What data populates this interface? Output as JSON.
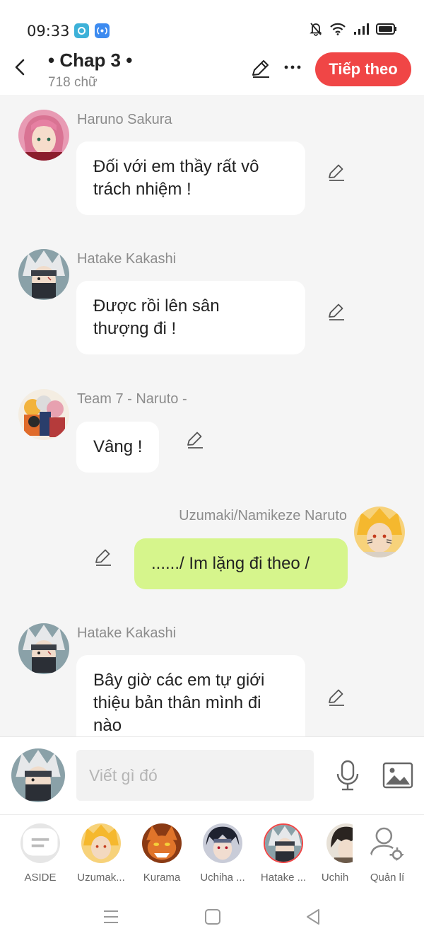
{
  "status_bar": {
    "time": "09:33"
  },
  "header": {
    "chapter_title": "• Chap 3 •",
    "word_count": "718 chữ",
    "next_button": "Tiếp theo"
  },
  "messages": [
    {
      "name": "Haruno Sakura",
      "text_lines": [
        "Đối với em thầy rất vô",
        "trách nhiệm !"
      ]
    },
    {
      "name": "Hatake Kakashi",
      "text_lines": [
        "Được rồi lên sân",
        "thượng đi !"
      ]
    },
    {
      "name": "Team 7 - Naruto -",
      "text_lines": [
        "Vâng !"
      ]
    },
    {
      "name": "Uzumaki/Namikeze Naruto",
      "text_lines": [
        "....../ Im lặng đi theo /"
      ]
    },
    {
      "name": "Hatake Kakashi",
      "text_lines": [
        "Bây giờ các em tự giới",
        "thiệu bản thân mình đi",
        "nào"
      ]
    }
  ],
  "input": {
    "placeholder": "Viết gì đó"
  },
  "characters": [
    {
      "label": "ASIDE"
    },
    {
      "label": "Uzumak..."
    },
    {
      "label": "Kurama"
    },
    {
      "label": "Uchiha ..."
    },
    {
      "label": "Hatake ..."
    },
    {
      "label": "Uchih"
    },
    {
      "label": "Quản lí"
    }
  ],
  "colors": {
    "accent": "#f04646",
    "own_bubble": "#d6f58c",
    "chat_background": "#f5f5f5"
  }
}
